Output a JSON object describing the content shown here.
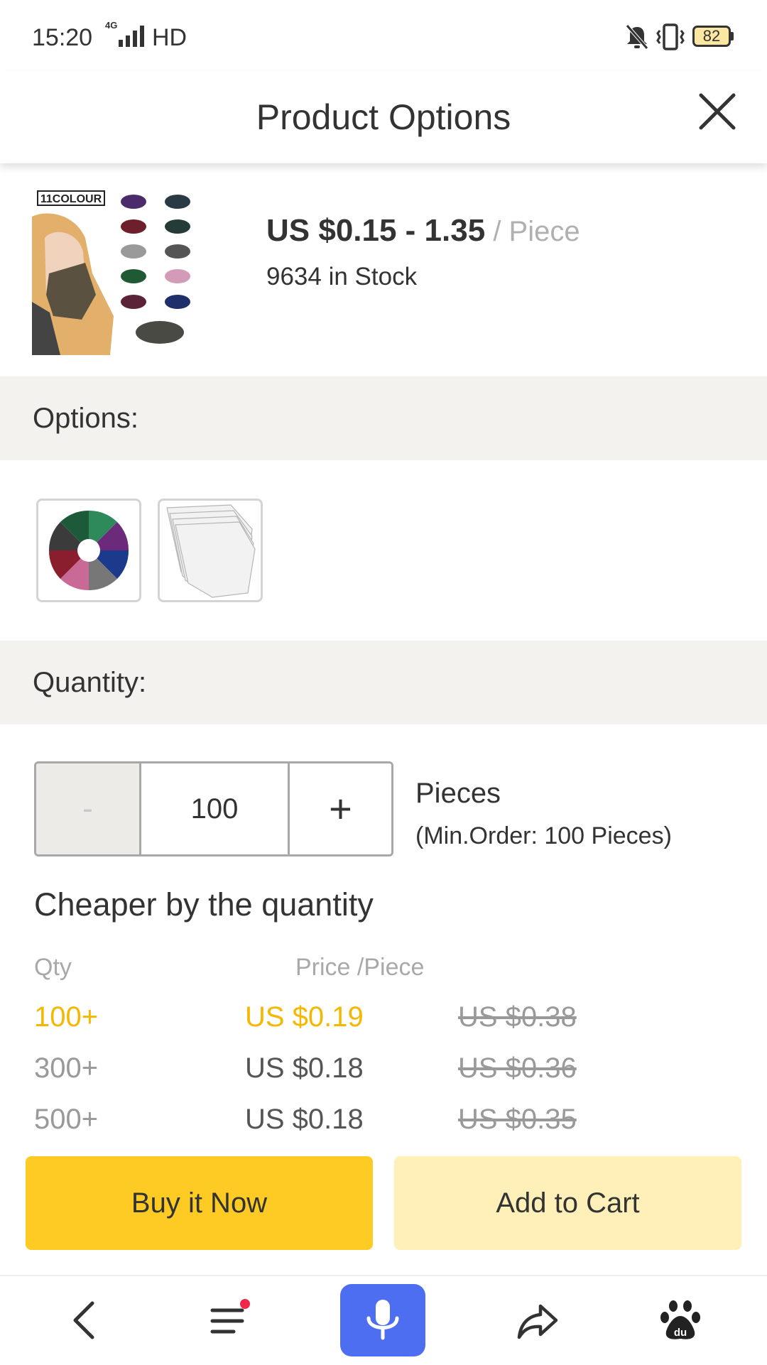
{
  "status_bar": {
    "time": "15:20",
    "network": "4G",
    "hd": "HD",
    "battery": "82"
  },
  "header": {
    "title": "Product Options"
  },
  "product": {
    "price_range": "US $0.15 - 1.35",
    "price_unit": " / Piece",
    "stock": "9634 in Stock",
    "image_text": "11COLOUR"
  },
  "options": {
    "label": "Options:"
  },
  "quantity": {
    "label": "Quantity:",
    "minus": "-",
    "value": "100",
    "plus": "+",
    "unit": "Pieces",
    "min_order": "(Min.Order: 100 Pieces)"
  },
  "pricing": {
    "title": "Cheaper by the quantity",
    "qty_header": "Qty",
    "price_header": "Price /Piece",
    "tiers": [
      {
        "qty": "100+",
        "price": "US $0.19",
        "old_price": "US $0.38"
      },
      {
        "qty": "300+",
        "price": "US $0.18",
        "old_price": "US $0.36"
      },
      {
        "qty": "500+",
        "price": "US $0.18",
        "old_price": "US $0.35"
      }
    ]
  },
  "actions": {
    "buy_now": "Buy it Now",
    "add_to_cart": "Add to Cart"
  },
  "colors": {
    "accent_yellow": "#fdcb23",
    "cart_yellow": "#fef0b8",
    "active_tier": "#f5b800",
    "mic_blue": "#4e6ef2",
    "band_gray": "#f3f2ef"
  },
  "icons": {
    "close": "close-icon",
    "back": "back-arrow-icon",
    "menu": "menu-icon",
    "mic": "microphone-icon",
    "share": "share-icon",
    "baidu": "baidu-paw-icon"
  }
}
